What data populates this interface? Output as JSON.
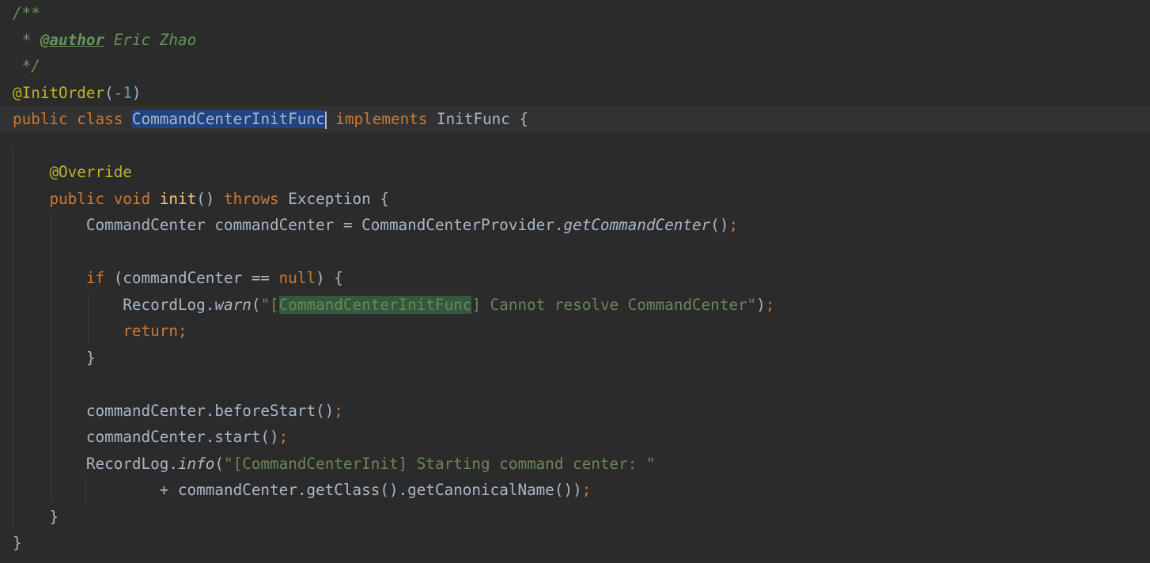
{
  "editor": {
    "lines": [
      [
        {
          "t": "/**",
          "c": "cmt"
        }
      ],
      [
        {
          "t": " * ",
          "c": "cmt"
        },
        {
          "t": "@author",
          "c": "cmt-tag"
        },
        {
          "t": " Eric Zhao",
          "c": "cmt"
        }
      ],
      [
        {
          "t": " */",
          "c": "cmt"
        }
      ],
      [
        {
          "t": "@InitOrder",
          "c": "ann"
        },
        {
          "t": "(",
          "c": ""
        },
        {
          "t": "-1",
          "c": "num"
        },
        {
          "t": ")",
          "c": ""
        }
      ],
      [
        {
          "t": "public class ",
          "c": "kw"
        },
        {
          "t": "CommandCenterInitFunc",
          "c": "sel"
        },
        {
          "t": "",
          "c": "caret"
        },
        {
          "t": " implements ",
          "c": "kw"
        },
        {
          "t": "InitFunc {",
          "c": ""
        }
      ],
      [],
      [
        {
          "t": "    ",
          "c": ""
        },
        {
          "t": "@Override",
          "c": "ann"
        }
      ],
      [
        {
          "t": "    ",
          "c": ""
        },
        {
          "t": "public void ",
          "c": "kw"
        },
        {
          "t": "init",
          "c": "fn"
        },
        {
          "t": "() ",
          "c": ""
        },
        {
          "t": "throws ",
          "c": "kw"
        },
        {
          "t": "Exception {",
          "c": ""
        }
      ],
      [
        {
          "t": "        CommandCenter commandCenter = CommandCenterProvider.",
          "c": ""
        },
        {
          "t": "getCommandCenter",
          "c": "static"
        },
        {
          "t": "()",
          "c": ""
        },
        {
          "t": ";",
          "c": "kw"
        }
      ],
      [],
      [
        {
          "t": "        ",
          "c": ""
        },
        {
          "t": "if ",
          "c": "kw"
        },
        {
          "t": "(commandCenter == ",
          "c": ""
        },
        {
          "t": "null",
          "c": "kw"
        },
        {
          "t": ") {",
          "c": ""
        }
      ],
      [
        {
          "t": "            RecordLog.",
          "c": ""
        },
        {
          "t": "warn",
          "c": "static"
        },
        {
          "t": "(",
          "c": ""
        },
        {
          "t": "\"[",
          "c": "str"
        },
        {
          "t": "CommandCenterInitFunc",
          "c": "str strhl"
        },
        {
          "t": "] Cannot resolve CommandCenter\"",
          "c": "str"
        },
        {
          "t": ")",
          "c": ""
        },
        {
          "t": ";",
          "c": "kw"
        }
      ],
      [
        {
          "t": "            ",
          "c": ""
        },
        {
          "t": "return;",
          "c": "kw"
        }
      ],
      [
        {
          "t": "        }",
          "c": ""
        }
      ],
      [],
      [
        {
          "t": "        commandCenter.beforeStart()",
          "c": ""
        },
        {
          "t": ";",
          "c": "kw"
        }
      ],
      [
        {
          "t": "        commandCenter.start()",
          "c": ""
        },
        {
          "t": ";",
          "c": "kw"
        }
      ],
      [
        {
          "t": "        RecordLog.",
          "c": ""
        },
        {
          "t": "info",
          "c": "static"
        },
        {
          "t": "(",
          "c": ""
        },
        {
          "t": "\"[CommandCenterInit] Starting command center: \"",
          "c": "str"
        }
      ],
      [
        {
          "t": "                + commandCenter.getClass().getCanonicalName())",
          "c": ""
        },
        {
          "t": ";",
          "c": "kw"
        }
      ],
      [
        {
          "t": "    }",
          "c": ""
        }
      ],
      [
        {
          "t": "}",
          "c": ""
        }
      ]
    ]
  },
  "colors": {
    "background": "#2b2b2b",
    "current_line": "#323232",
    "keyword": "#cc7832",
    "annotation": "#bbb529",
    "string": "#6a8759",
    "comment": "#629755",
    "number": "#6897bb",
    "method": "#ffc66d",
    "selection": "#214283"
  }
}
